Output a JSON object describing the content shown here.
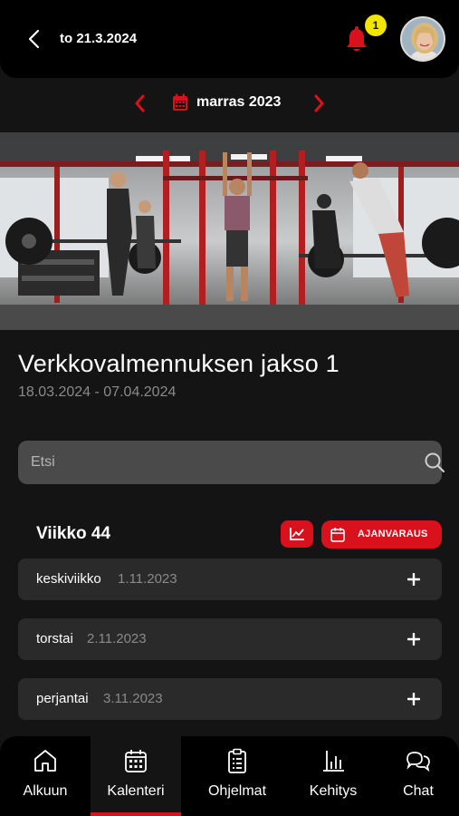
{
  "header": {
    "date_label": "to 21.3.2024",
    "notification_count": "1"
  },
  "month_nav": {
    "label": "marras 2023"
  },
  "program": {
    "title": "Verkkovalmennuksen jakso 1",
    "date_range": "18.03.2024 - 07.04.2024"
  },
  "search": {
    "placeholder": "Etsi"
  },
  "week": {
    "label": "Viikko 44",
    "booking_label": "AJANVARAUS",
    "days": [
      {
        "name": "keskiviikko",
        "date": "1.11.2023"
      },
      {
        "name": "torstai",
        "date": "2.11.2023"
      },
      {
        "name": "perjantai",
        "date": "3.11.2023"
      }
    ]
  },
  "bottom_nav": {
    "items": [
      {
        "label": "Alkuun",
        "icon": "home-icon"
      },
      {
        "label": "Kalenteri",
        "icon": "calendar-icon",
        "active": true
      },
      {
        "label": "Ohjelmat",
        "icon": "clipboard-icon"
      },
      {
        "label": "Kehitys",
        "icon": "bar-chart-icon"
      },
      {
        "label": "Chat",
        "icon": "chat-icon"
      }
    ]
  },
  "colors": {
    "accent": "#d8111c",
    "badge": "#f2e600",
    "background": "#141414"
  }
}
